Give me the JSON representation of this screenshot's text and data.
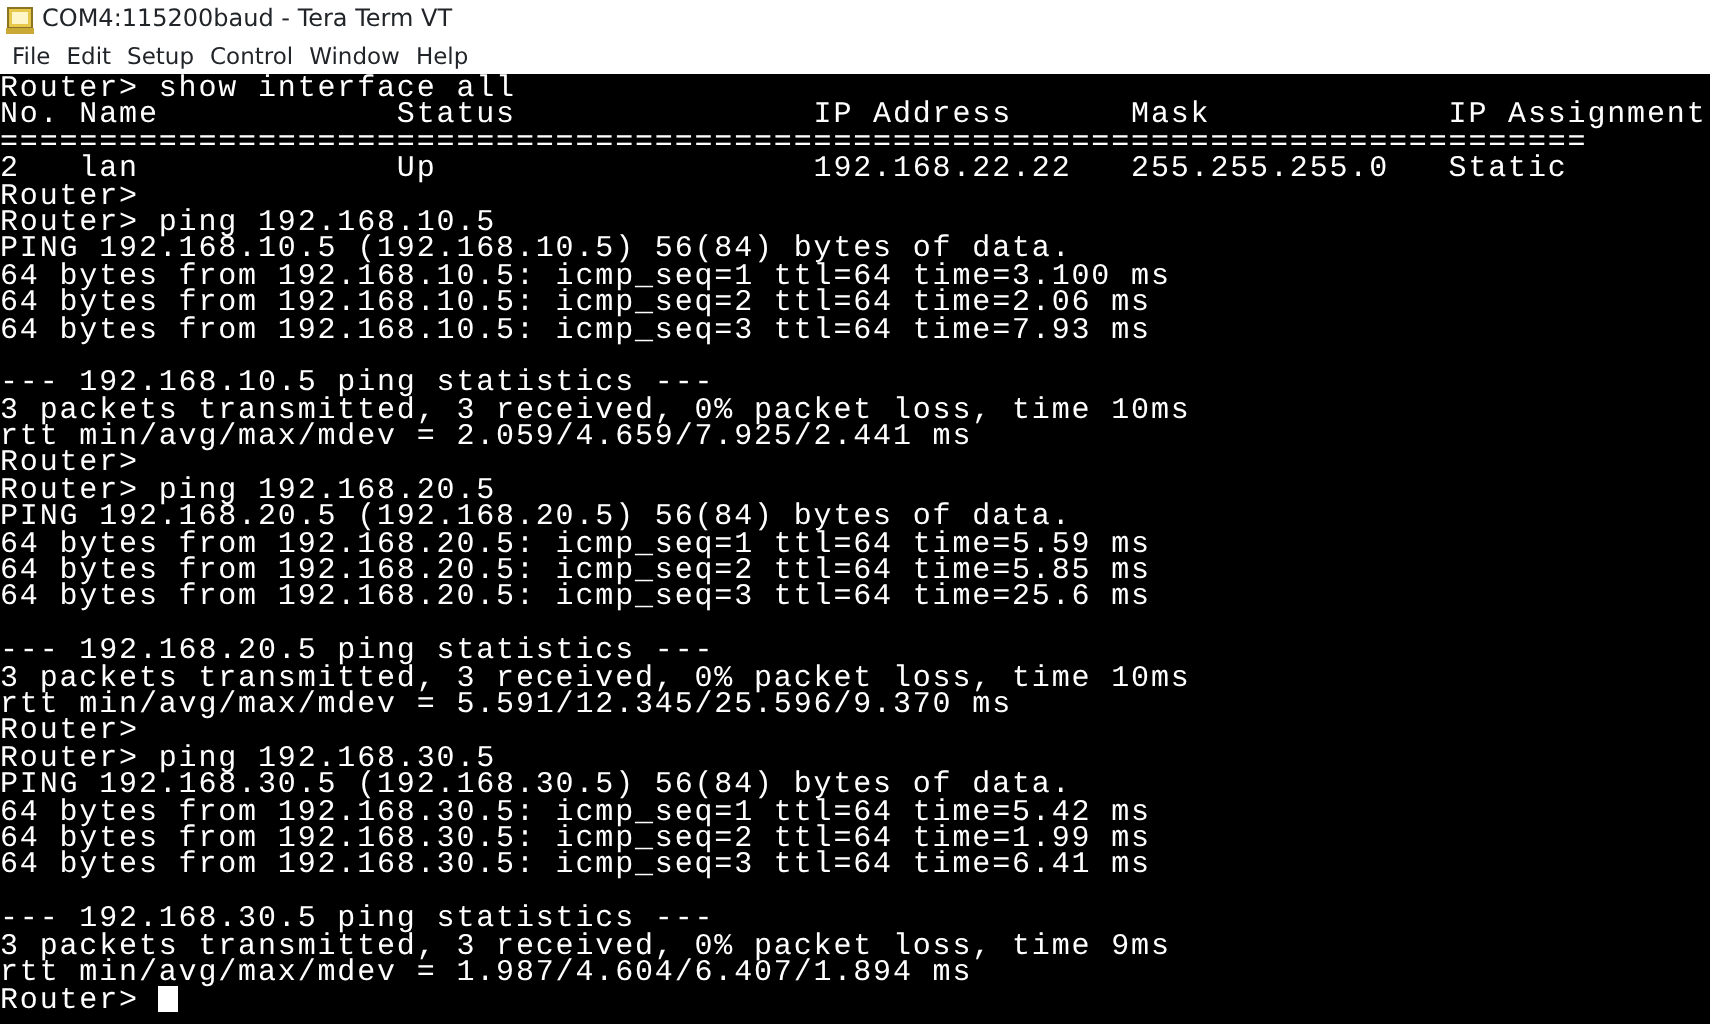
{
  "window": {
    "title": "COM4:115200baud - Tera Term VT"
  },
  "menu": [
    "File",
    "Edit",
    "Setup",
    "Control",
    "Window",
    "Help"
  ],
  "terminal": {
    "lines": [
      {
        "kind": "text",
        "text": "Router> show interface all"
      },
      {
        "kind": "text",
        "text": "No. Name            Status               IP Address      Mask            IP Assignment"
      },
      {
        "kind": "text",
        "text": "================================================================================"
      },
      {
        "kind": "text",
        "text": "2   lan             Up                   192.168.22.22   255.255.255.0   Static"
      },
      {
        "kind": "text",
        "text": "Router>"
      },
      {
        "kind": "text",
        "text": "Router> ping 192.168.10.5"
      },
      {
        "kind": "text",
        "text": "PING 192.168.10.5 (192.168.10.5) 56(84) bytes of data."
      },
      {
        "kind": "text",
        "text": "64 bytes from 192.168.10.5: icmp_seq=1 ttl=64 time=3.100 ms"
      },
      {
        "kind": "text",
        "text": "64 bytes from 192.168.10.5: icmp_seq=2 ttl=64 time=2.06 ms"
      },
      {
        "kind": "text",
        "text": "64 bytes from 192.168.10.5: icmp_seq=3 ttl=64 time=7.93 ms"
      },
      {
        "kind": "gap"
      },
      {
        "kind": "text",
        "text": "--- 192.168.10.5 ping statistics ---"
      },
      {
        "kind": "text",
        "text": "3 packets transmitted, 3 received, 0% packet loss, time 10ms"
      },
      {
        "kind": "text",
        "text": "rtt min/avg/max/mdev = 2.059/4.659/7.925/2.441 ms"
      },
      {
        "kind": "text",
        "text": "Router>"
      },
      {
        "kind": "text",
        "text": "Router> ping 192.168.20.5"
      },
      {
        "kind": "text",
        "text": "PING 192.168.20.5 (192.168.20.5) 56(84) bytes of data."
      },
      {
        "kind": "text",
        "text": "64 bytes from 192.168.20.5: icmp_seq=1 ttl=64 time=5.59 ms"
      },
      {
        "kind": "text",
        "text": "64 bytes from 192.168.20.5: icmp_seq=2 ttl=64 time=5.85 ms"
      },
      {
        "kind": "text",
        "text": "64 bytes from 192.168.20.5: icmp_seq=3 ttl=64 time=25.6 ms"
      },
      {
        "kind": "gap"
      },
      {
        "kind": "text",
        "text": "--- 192.168.20.5 ping statistics ---"
      },
      {
        "kind": "text",
        "text": "3 packets transmitted, 3 received, 0% packet loss, time 10ms"
      },
      {
        "kind": "text",
        "text": "rtt min/avg/max/mdev = 5.591/12.345/25.596/9.370 ms"
      },
      {
        "kind": "text",
        "text": "Router>"
      },
      {
        "kind": "text",
        "text": "Router> ping 192.168.30.5"
      },
      {
        "kind": "text",
        "text": "PING 192.168.30.5 (192.168.30.5) 56(84) bytes of data."
      },
      {
        "kind": "text",
        "text": "64 bytes from 192.168.30.5: icmp_seq=1 ttl=64 time=5.42 ms"
      },
      {
        "kind": "text",
        "text": "64 bytes from 192.168.30.5: icmp_seq=2 ttl=64 time=1.99 ms"
      },
      {
        "kind": "text",
        "text": "64 bytes from 192.168.30.5: icmp_seq=3 ttl=64 time=6.41 ms"
      },
      {
        "kind": "gap"
      },
      {
        "kind": "text",
        "text": "--- 192.168.30.5 ping statistics ---"
      },
      {
        "kind": "text",
        "text": "3 packets transmitted, 3 received, 0% packet loss, time 9ms"
      },
      {
        "kind": "text",
        "text": "rtt min/avg/max/mdev = 1.987/4.604/6.407/1.894 ms"
      },
      {
        "kind": "prompt",
        "text": "Router>"
      }
    ]
  }
}
